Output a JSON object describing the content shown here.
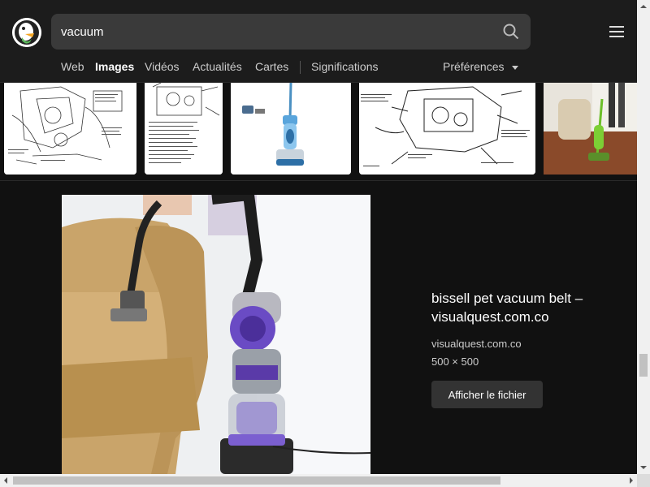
{
  "search": {
    "query": "vacuum"
  },
  "nav": {
    "items": [
      "Web",
      "Images",
      "Vidéos",
      "Actualités",
      "Cartes",
      "Significations"
    ],
    "active": "Images",
    "preferences": "Préférences"
  },
  "detail": {
    "title": "bissell pet vacuum belt – visualquest.com.co",
    "domain": "visualquest.com.co",
    "size": "500 × 500",
    "open_button": "Afficher le fichier"
  },
  "colors": {
    "background": "#111111",
    "header": "#1c1c1c",
    "search_box": "#3a3a3a",
    "accent_purple": "#6a4bc4"
  }
}
